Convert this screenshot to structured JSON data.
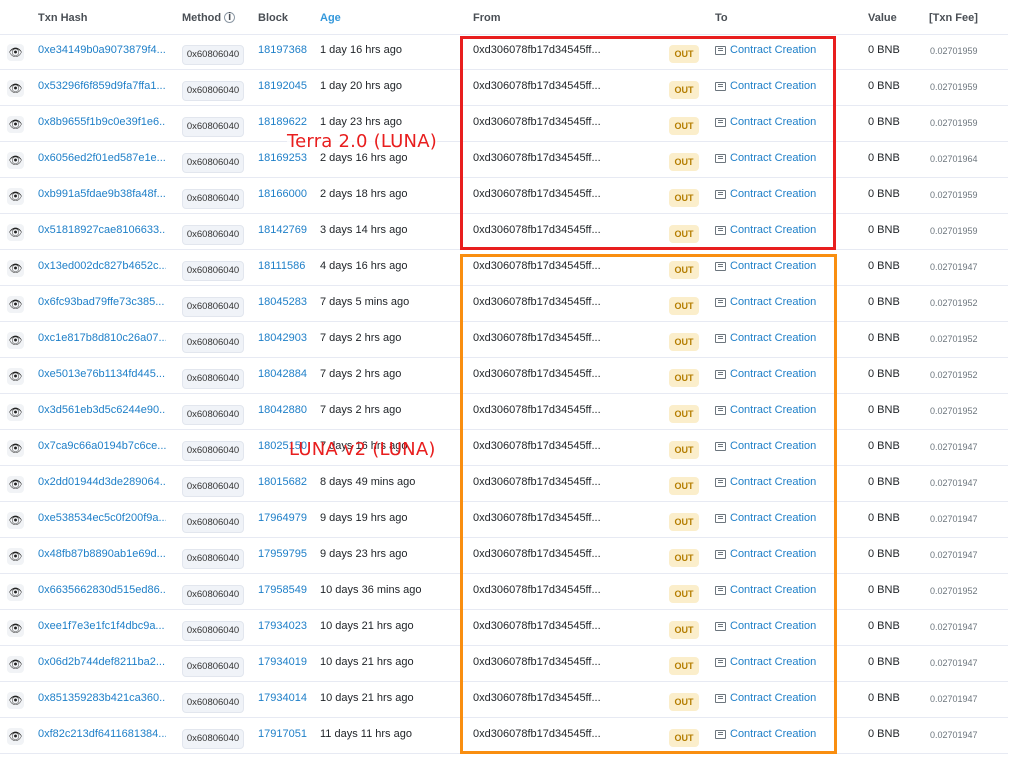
{
  "headers": {
    "txn_hash": "Txn Hash",
    "method": "Method",
    "method_info": "i",
    "block": "Block",
    "age": "Age",
    "from": "From",
    "to": "To",
    "value": "Value",
    "txn_fee": "[Txn Fee]"
  },
  "icons": {
    "row_action": "eye-icon",
    "contract": "contract-doc-icon"
  },
  "rows": [
    {
      "hash": "0xe34149b0a9073879f4...",
      "method": "0x60806040",
      "block": "18197368",
      "age": "1 day 16 hrs ago",
      "from": "0xd306078fb17d34545ff...",
      "direction": "OUT",
      "to": "Contract Creation",
      "value": "0 BNB",
      "fee": "0.02701959"
    },
    {
      "hash": "0x53296f6f859d9fa7ffa1...",
      "method": "0x60806040",
      "block": "18192045",
      "age": "1 day 20 hrs ago",
      "from": "0xd306078fb17d34545ff...",
      "direction": "OUT",
      "to": "Contract Creation",
      "value": "0 BNB",
      "fee": "0.02701959"
    },
    {
      "hash": "0x8b9655f1b9c0e39f1e6...",
      "method": "0x60806040",
      "block": "18189622",
      "age": "1 day 23 hrs ago",
      "from": "0xd306078fb17d34545ff...",
      "direction": "OUT",
      "to": "Contract Creation",
      "value": "0 BNB",
      "fee": "0.02701959"
    },
    {
      "hash": "0x6056ed2f01ed587e1e...",
      "method": "0x60806040",
      "block": "18169253",
      "age": "2 days 16 hrs ago",
      "from": "0xd306078fb17d34545ff...",
      "direction": "OUT",
      "to": "Contract Creation",
      "value": "0 BNB",
      "fee": "0.02701964"
    },
    {
      "hash": "0xb991a5fdae9b38fa48f...",
      "method": "0x60806040",
      "block": "18166000",
      "age": "2 days 18 hrs ago",
      "from": "0xd306078fb17d34545ff...",
      "direction": "OUT",
      "to": "Contract Creation",
      "value": "0 BNB",
      "fee": "0.02701959"
    },
    {
      "hash": "0x51818927cae8106633...",
      "method": "0x60806040",
      "block": "18142769",
      "age": "3 days 14 hrs ago",
      "from": "0xd306078fb17d34545ff...",
      "direction": "OUT",
      "to": "Contract Creation",
      "value": "0 BNB",
      "fee": "0.02701959"
    },
    {
      "hash": "0x13ed002dc827b4652c...",
      "method": "0x60806040",
      "block": "18111586",
      "age": "4 days 16 hrs ago",
      "from": "0xd306078fb17d34545ff...",
      "direction": "OUT",
      "to": "Contract Creation",
      "value": "0 BNB",
      "fee": "0.02701947"
    },
    {
      "hash": "0x6fc93bad79ffe73c385...",
      "method": "0x60806040",
      "block": "18045283",
      "age": "7 days 5 mins ago",
      "from": "0xd306078fb17d34545ff...",
      "direction": "OUT",
      "to": "Contract Creation",
      "value": "0 BNB",
      "fee": "0.02701952"
    },
    {
      "hash": "0xc1e817b8d810c26a07...",
      "method": "0x60806040",
      "block": "18042903",
      "age": "7 days 2 hrs ago",
      "from": "0xd306078fb17d34545ff...",
      "direction": "OUT",
      "to": "Contract Creation",
      "value": "0 BNB",
      "fee": "0.02701952"
    },
    {
      "hash": "0xe5013e76b1134fd445...",
      "method": "0x60806040",
      "block": "18042884",
      "age": "7 days 2 hrs ago",
      "from": "0xd306078fb17d34545ff...",
      "direction": "OUT",
      "to": "Contract Creation",
      "value": "0 BNB",
      "fee": "0.02701952"
    },
    {
      "hash": "0x3d561eb3d5c6244e90...",
      "method": "0x60806040",
      "block": "18042880",
      "age": "7 days 2 hrs ago",
      "from": "0xd306078fb17d34545ff...",
      "direction": "OUT",
      "to": "Contract Creation",
      "value": "0 BNB",
      "fee": "0.02701952"
    },
    {
      "hash": "0x7ca9c66a0194b7c6ce...",
      "method": "0x60806040",
      "block": "18025150",
      "age": "7 days 16 hrs ago",
      "from": "0xd306078fb17d34545ff...",
      "direction": "OUT",
      "to": "Contract Creation",
      "value": "0 BNB",
      "fee": "0.02701947"
    },
    {
      "hash": "0x2dd01944d3de289064...",
      "method": "0x60806040",
      "block": "18015682",
      "age": "8 days 49 mins ago",
      "from": "0xd306078fb17d34545ff...",
      "direction": "OUT",
      "to": "Contract Creation",
      "value": "0 BNB",
      "fee": "0.02701947"
    },
    {
      "hash": "0xe538534ec5c0f200f9a...",
      "method": "0x60806040",
      "block": "17964979",
      "age": "9 days 19 hrs ago",
      "from": "0xd306078fb17d34545ff...",
      "direction": "OUT",
      "to": "Contract Creation",
      "value": "0 BNB",
      "fee": "0.02701947"
    },
    {
      "hash": "0x48fb87b8890ab1e69d...",
      "method": "0x60806040",
      "block": "17959795",
      "age": "9 days 23 hrs ago",
      "from": "0xd306078fb17d34545ff...",
      "direction": "OUT",
      "to": "Contract Creation",
      "value": "0 BNB",
      "fee": "0.02701947"
    },
    {
      "hash": "0x6635662830d515ed86...",
      "method": "0x60806040",
      "block": "17958549",
      "age": "10 days 36 mins ago",
      "from": "0xd306078fb17d34545ff...",
      "direction": "OUT",
      "to": "Contract Creation",
      "value": "0 BNB",
      "fee": "0.02701952"
    },
    {
      "hash": "0xee1f7e3e1fc1f4dbc9a...",
      "method": "0x60806040",
      "block": "17934023",
      "age": "10 days 21 hrs ago",
      "from": "0xd306078fb17d34545ff...",
      "direction": "OUT",
      "to": "Contract Creation",
      "value": "0 BNB",
      "fee": "0.02701947"
    },
    {
      "hash": "0x06d2b744def8211ba2...",
      "method": "0x60806040",
      "block": "17934019",
      "age": "10 days 21 hrs ago",
      "from": "0xd306078fb17d34545ff...",
      "direction": "OUT",
      "to": "Contract Creation",
      "value": "0 BNB",
      "fee": "0.02701947"
    },
    {
      "hash": "0x851359283b421ca360...",
      "method": "0x60806040",
      "block": "17934014",
      "age": "10 days 21 hrs ago",
      "from": "0xd306078fb17d34545ff...",
      "direction": "OUT",
      "to": "Contract Creation",
      "value": "0 BNB",
      "fee": "0.02701947"
    },
    {
      "hash": "0xf82c213df6411681384...",
      "method": "0x60806040",
      "block": "17917051",
      "age": "11 days 11 hrs ago",
      "from": "0xd306078fb17d34545ff...",
      "direction": "OUT",
      "to": "Contract Creation",
      "value": "0 BNB",
      "fee": "0.02701947"
    }
  ],
  "annotations": {
    "terra": "Terra 2.0 (LUNA)",
    "luna_v2": "LUNA v2 (LUNA)",
    "red_color": "#e81e1e",
    "orange_color": "#f98e10"
  }
}
